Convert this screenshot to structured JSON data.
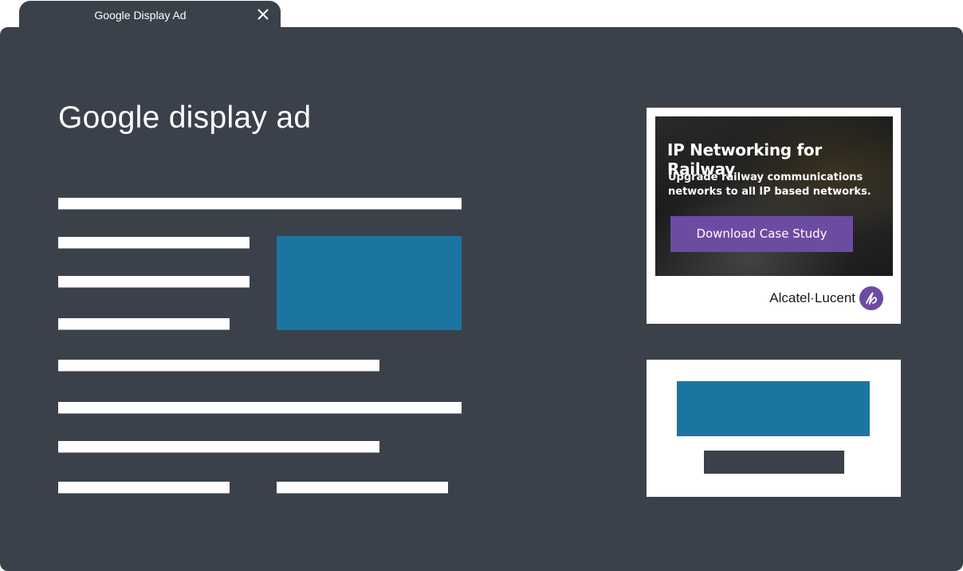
{
  "tab": {
    "title": "Google Display Ad",
    "close_icon": "close-icon"
  },
  "main": {
    "title": "Google display ad"
  },
  "ad": {
    "headline": "IP Networking for Railway",
    "body": "Upgrade railway communications networks to all IP based networks.",
    "cta_label": "Download Case Study",
    "brand_name": "Alcatel·Lucent",
    "brand_logo_icon": "alcatel-lucent-logo-icon",
    "colors": {
      "cta": "#6c4ca2",
      "logo": "#6c4ca2"
    }
  },
  "colors": {
    "window": "#3a414b",
    "accent_block": "#1c75a1",
    "placeholder_line": "#ffffff"
  }
}
